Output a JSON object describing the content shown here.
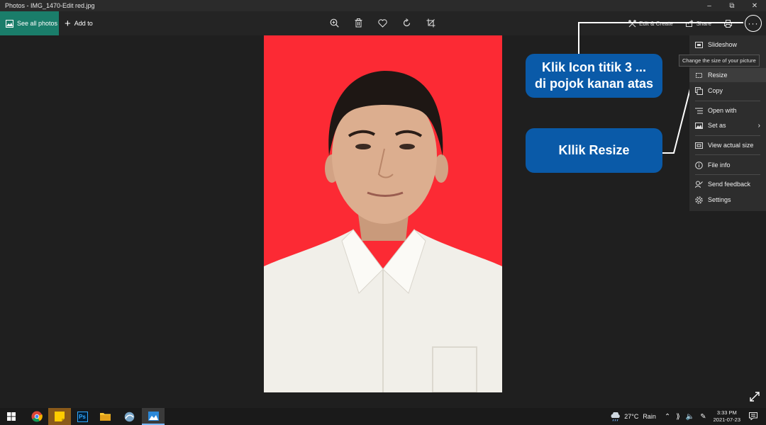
{
  "window": {
    "title": "Photos - IMG_1470-Edit red.jpg"
  },
  "toolbar": {
    "see_all": "See all photos",
    "add_to": "Add to",
    "edit_create": "Edit & Create",
    "share": "Share",
    "more": "···"
  },
  "menu": {
    "items": [
      "Slideshow",
      "Resize",
      "Copy",
      "Open with",
      "Set as",
      "View actual size",
      "File info",
      "Send feedback",
      "Settings"
    ],
    "tooltip": "Change the size of your picture"
  },
  "callouts": {
    "first_line1": "Klik Icon titik 3 ...",
    "first_line2": "di pojok kanan atas",
    "second": "Kllik Resize"
  },
  "taskbar": {
    "weather_temp": "27°C",
    "weather_desc": "Rain",
    "time": "3:33 PM",
    "date": "2021-07-23"
  },
  "colors": {
    "accent": "#1a7d6a",
    "photo_bg": "#fc2a34",
    "callout": "#0a5aa8"
  }
}
